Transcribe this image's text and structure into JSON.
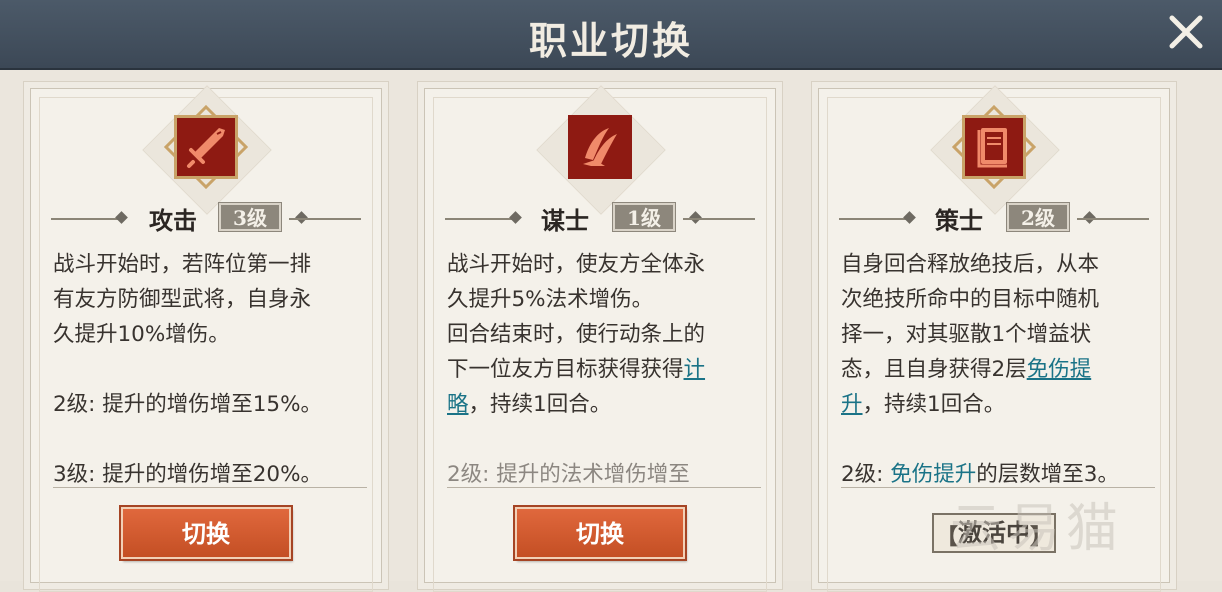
{
  "header": {
    "title": "职业切换",
    "close_icon": "close-icon"
  },
  "colors": {
    "accent_orange": "#d35d30",
    "link_teal": "#1a7387",
    "icon_red": "#8e1a12",
    "header_bg": "#46525f"
  },
  "cards": [
    {
      "icon": "sword-icon",
      "name": "攻击",
      "level": "3级",
      "desc": {
        "l1": "战斗开始时，若阵位第一排",
        "l2": "有友方防御型武将，自身永",
        "l3": "久提升10%增伤。",
        "l4": "2级: 提升的增伤增至15%。",
        "l5": "3级: 提升的增伤增至20%。"
      },
      "button": "切换"
    },
    {
      "icon": "claw-icon",
      "name": "谋士",
      "level": "1级",
      "desc": {
        "l1": "战斗开始时，使友方全体永",
        "l2": "久提升5%法术增伤。",
        "l3": "回合结束时，使行动条上的",
        "l4a": "下一位友方目标获得获得",
        "l4b": "计",
        "l5a": "略",
        "l5b": "，持续1回合。",
        "l6": "2级: 提升的法术增伤增至"
      },
      "button": "切换"
    },
    {
      "icon": "book-icon",
      "name": "策士",
      "level": "2级",
      "desc": {
        "l1": "自身回合释放绝技后，从本",
        "l2": "次绝技所命中的目标中随机",
        "l3": "择一，对其驱散1个增益状",
        "l4a": "态，且自身获得2层",
        "l4b": "免伤提",
        "l5a": "升",
        "l5b": "，持续1回合。",
        "l6a": "2级: ",
        "l6b": "免伤提升",
        "l6c": "的层数增至3。"
      },
      "status": "激活中",
      "status_left": "【",
      "status_right": "】"
    }
  ],
  "watermark": "云易猫"
}
